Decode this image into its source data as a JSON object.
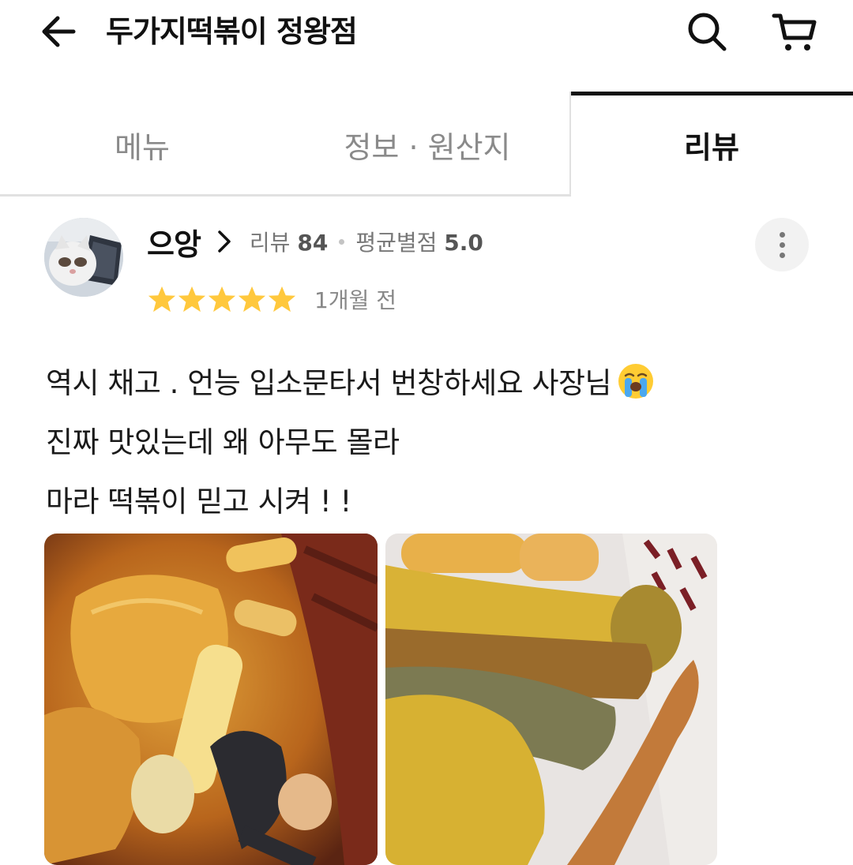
{
  "header": {
    "store_name": "두가지떡볶이 정왕점",
    "back_icon": "arrow-left-icon",
    "search_icon": "search-icon",
    "cart_icon": "cart-icon"
  },
  "tabs": [
    {
      "label": "메뉴",
      "active": false
    },
    {
      "label": "정보 · 원산지",
      "active": false
    },
    {
      "label": "리뷰",
      "active": true
    }
  ],
  "review": {
    "reviewer_name": "으앙",
    "review_count_label": "리뷰",
    "review_count": "84",
    "avg_rating_label": "평균별점",
    "avg_rating": "5.0",
    "rating": 5,
    "max_rating": 5,
    "date": "1개월 전",
    "text_lines": [
      "역시 채고 . 언능 입소문타서 번창하세요 사장님",
      "진짜 맛있는데 왜 아무도 몰라",
      "마라 떡볶이 믿고 시켜 ! !"
    ],
    "emoji": "crying-face-emoji",
    "photos": [
      "tteokbokki-photo",
      "fried-food-photo"
    ]
  },
  "colors": {
    "accent_star": "#FFC83D",
    "active_tab_line": "#111111",
    "muted_text": "#8a8a8a"
  }
}
